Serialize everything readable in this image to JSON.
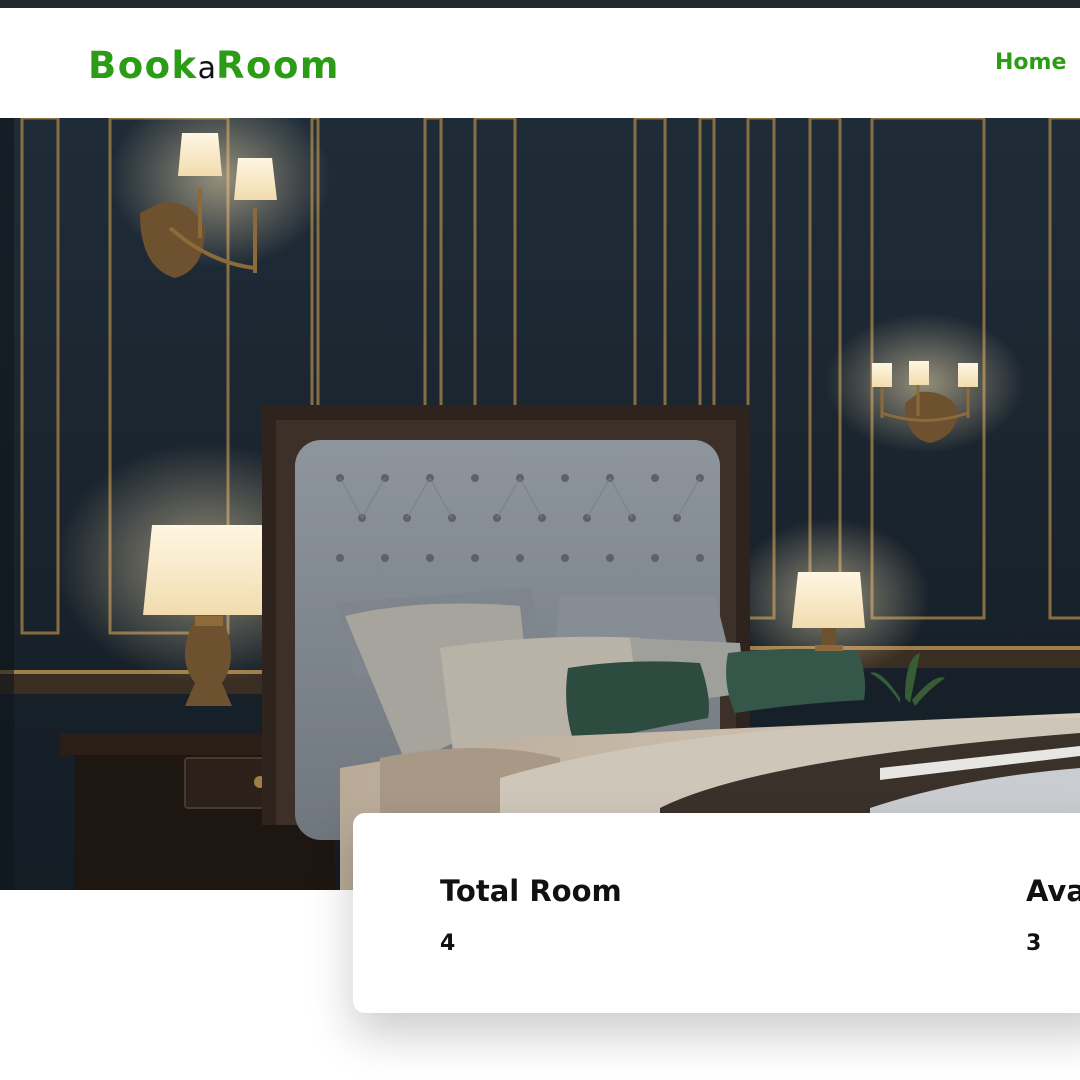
{
  "brand": {
    "part1": "Book",
    "part2": "a",
    "part3": "Room"
  },
  "nav": {
    "home": "Home"
  },
  "hero": {
    "image_name": "luxury-bedroom-photo"
  },
  "stats": [
    {
      "label": "Total Room",
      "value": "4"
    },
    {
      "label": "Ava",
      "value": "3"
    }
  ],
  "colors": {
    "brand": "#2c9c17",
    "text": "#111111",
    "topbar": "#25272e"
  }
}
